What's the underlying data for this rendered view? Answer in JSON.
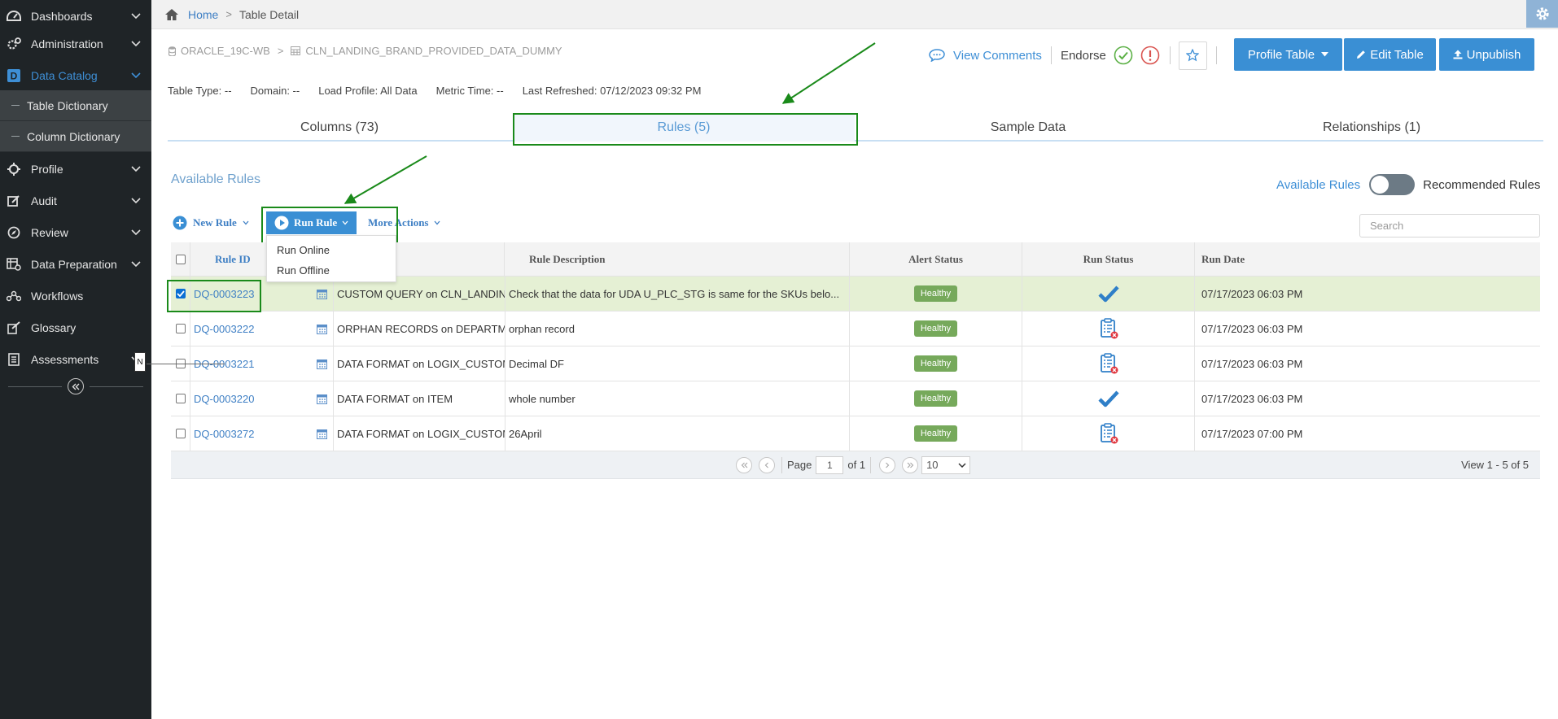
{
  "sidebar": {
    "items": [
      {
        "label": "Dashboards",
        "icon": "dashboard-icon",
        "chevron": true
      },
      {
        "label": "Administration",
        "icon": "cogs-icon",
        "chevron": true
      },
      {
        "label": "Data Catalog",
        "icon": "catalog-icon",
        "chevron": true,
        "active": true
      },
      {
        "label": "Profile",
        "icon": "crosshair-icon",
        "chevron": true
      },
      {
        "label": "Audit",
        "icon": "edit-icon",
        "chevron": true
      },
      {
        "label": "Review",
        "icon": "compass-icon",
        "chevron": true
      },
      {
        "label": "Data Preparation",
        "icon": "data-prep-icon",
        "chevron": true
      },
      {
        "label": "Workflows",
        "icon": "workflow-icon",
        "chevron": false
      },
      {
        "label": "Glossary",
        "icon": "glossary-icon",
        "chevron": false
      },
      {
        "label": "Assessments",
        "icon": "assessment-icon",
        "chevron": true
      }
    ],
    "sub_items": [
      "Table Dictionary",
      "Column Dictionary"
    ],
    "tooltip_letter": "N"
  },
  "breadcrumb": {
    "home": "Home",
    "separator": ">",
    "current": "Table Detail"
  },
  "table_path": {
    "database": "ORACLE_19C-WB",
    "separator": ">",
    "table": "CLN_LANDING_BRAND_PROVIDED_DATA_DUMMY"
  },
  "actions": {
    "view_comments": "View Comments",
    "endorse": "Endorse",
    "profile_table": "Profile Table",
    "edit_table": "Edit Table",
    "unpublish": "Unpublish"
  },
  "meta": {
    "table_type": "Table Type: --",
    "domain": "Domain: --",
    "load_profile": "Load Profile: All Data",
    "metric_time": "Metric Time: --",
    "last_refreshed": "Last Refreshed: 07/12/2023 09:32 PM"
  },
  "tabs": [
    {
      "label": "Columns (73)",
      "active": false
    },
    {
      "label": "Rules (5)",
      "active": true
    },
    {
      "label": "Sample Data",
      "active": false
    },
    {
      "label": "Relationships (1)",
      "active": false
    }
  ],
  "rules_panel": {
    "title": "Available Rules",
    "toggle_left": "Available Rules",
    "toggle_right": "Recommended Rules",
    "new_rule": "New Rule",
    "run_rule": "Run Rule",
    "more_actions": "More Actions",
    "run_menu": [
      "Run Online",
      "Run Offline"
    ],
    "search_placeholder": "Search"
  },
  "grid": {
    "columns": [
      "Rule ID",
      "Rule Description",
      "Alert Status",
      "Run Status",
      "Run Date"
    ],
    "rows": [
      {
        "id": "DQ-0003223",
        "name": "CUSTOM QUERY on CLN_LANDING_BRAND_PROVIDED_DATA_DUM...",
        "description": "Check that the data for UDA U_PLC_STG is same for the SKUs belo...",
        "alert": "Healthy",
        "run_status": "success",
        "run_date": "07/17/2023 06:03 PM",
        "checked": true
      },
      {
        "id": "DQ-0003222",
        "name": "ORPHAN RECORDS on DEPARTMENT",
        "description": "orphan record",
        "alert": "Healthy",
        "run_status": "failed",
        "run_date": "07/17/2023 06:03 PM",
        "checked": false
      },
      {
        "id": "DQ-0003221",
        "name": "DATA FORMAT on LOGIX_CUSTOM_NT_WT",
        "description": "Decimal DF",
        "alert": "Healthy",
        "run_status": "failed",
        "run_date": "07/17/2023 06:03 PM",
        "checked": false
      },
      {
        "id": "DQ-0003220",
        "name": "DATA FORMAT on ITEM",
        "description": "whole number",
        "alert": "Healthy",
        "run_status": "success",
        "run_date": "07/17/2023 06:03 PM",
        "checked": false
      },
      {
        "id": "DQ-0003272",
        "name": "DATA FORMAT on LOGIX_CUSTOM_NT_WT",
        "description": "26April",
        "alert": "Healthy",
        "run_status": "failed",
        "run_date": "07/17/2023 07:00 PM",
        "checked": false
      }
    ]
  },
  "pager": {
    "page_label": "Page",
    "page_value": "1",
    "of_label": "of 1",
    "page_size": "10",
    "view_count": "View 1 - 5 of 5"
  },
  "colors": {
    "sidebar_bg": "#1f2427",
    "accent": "#3a8fd4",
    "healthy": "#76a95b",
    "highlight": "#1a8a1a",
    "selected_row": "#e5f0d4"
  }
}
